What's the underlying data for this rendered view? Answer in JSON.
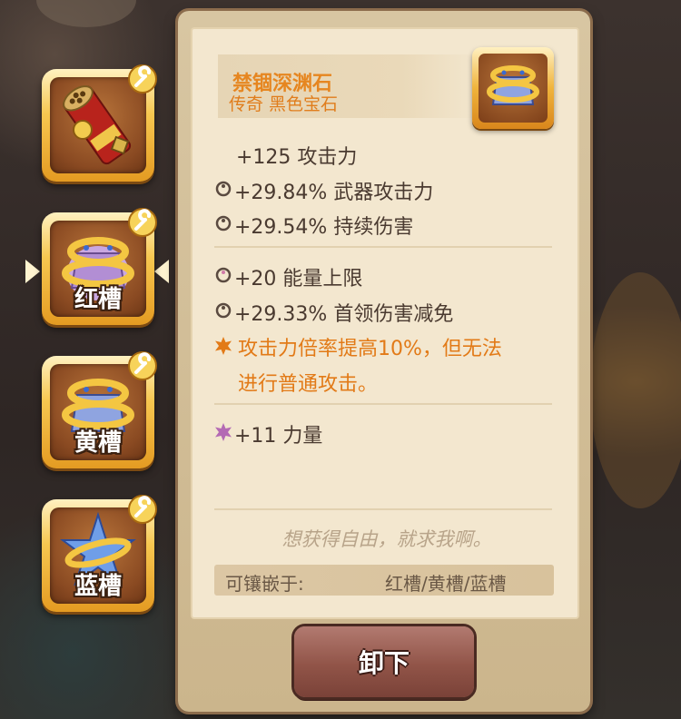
{
  "slots": [
    {
      "label": "",
      "icon": "dynamite-weapon-icon"
    },
    {
      "label": "红槽",
      "icon": "gold-ring-red-gem-icon",
      "selected": true
    },
    {
      "label": "黄槽",
      "icon": "gold-ring-blue-gem-icon"
    },
    {
      "label": "蓝槽",
      "icon": "blue-star-crystal-icon"
    }
  ],
  "item": {
    "name": "禁锢深渊石",
    "subtitle": "传奇 黑色宝石",
    "icon": "abyss-stone-icon"
  },
  "stats_group1": [
    {
      "text": "+125 攻击力",
      "icon": ""
    },
    {
      "text": "+29.84% 武器攻击力",
      "icon": "ring-icon"
    },
    {
      "text": "+29.54% 持续伤害",
      "icon": "ring-icon"
    }
  ],
  "stats_group2": [
    {
      "text": "+20 能量上限",
      "icon": "ring-pink-icon"
    },
    {
      "text": "+29.33% 首领伤害减免",
      "icon": "ring-icon"
    }
  ],
  "special": {
    "line1": "攻击力倍率提高10%，但无法",
    "line2": "进行普通攻击。",
    "icon": "orange-star-icon"
  },
  "stats_group3": [
    {
      "text": "+11 力量",
      "icon": "purple-star-icon"
    }
  ],
  "quote": "想获得自由，就求我啊。",
  "socket": {
    "label": "可镶嵌于:",
    "value": "红槽/黄槽/蓝槽"
  },
  "button": {
    "label": "卸下"
  },
  "colors": {
    "accent_orange": "#e68620",
    "text": "#4a3a30",
    "button": "#915448"
  }
}
